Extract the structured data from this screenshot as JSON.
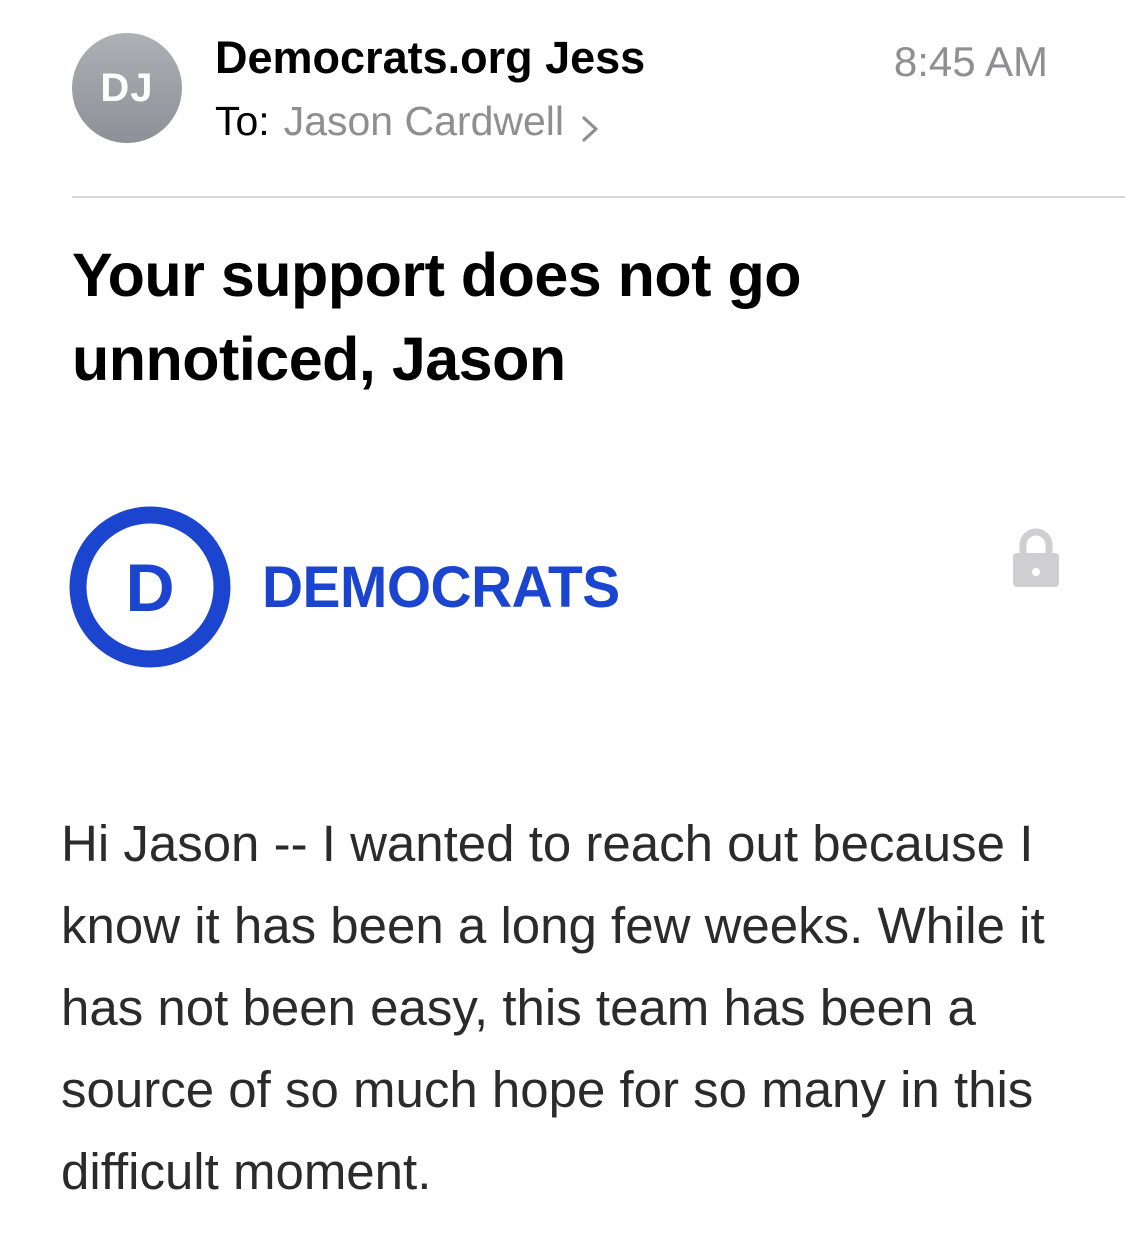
{
  "header": {
    "avatar_initials": "DJ",
    "sender": "Democrats.org Jess",
    "time": "8:45 AM",
    "to_label": "To:",
    "recipient": "Jason Cardwell"
  },
  "subject": "Your support does not go unnoticed, Jason",
  "logo": {
    "mark_letter": "D",
    "wordmark": "DEMOCRATS",
    "brand_color": "#1c45cf"
  },
  "lock_icon": "lock-icon",
  "body": {
    "paragraph": "Hi Jason -- I wanted to reach out because I know it has been a long few weeks. While it has not been easy, this team has been a source of so much hope for so many in this difficult moment."
  }
}
